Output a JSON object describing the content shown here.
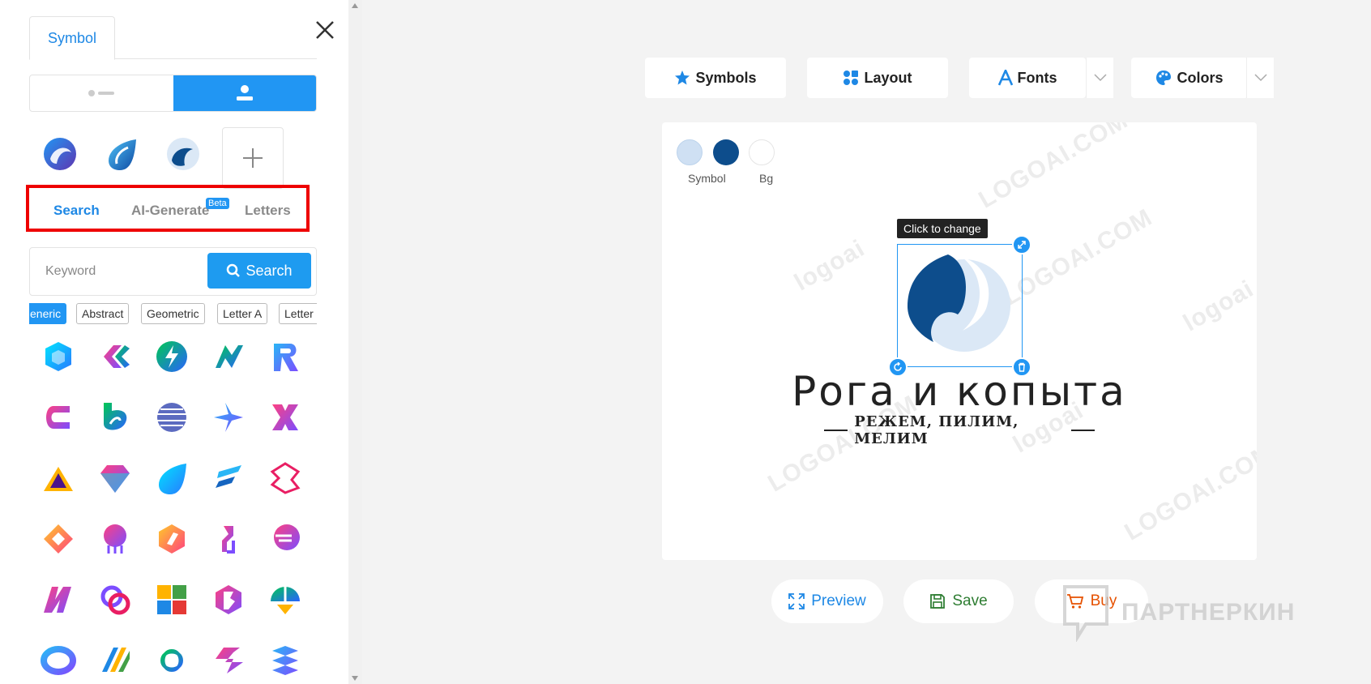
{
  "sidebar": {
    "tab_label": "Symbol",
    "source_tabs": {
      "search": "Search",
      "ai_generate": "AI-Generate",
      "beta_badge": "Beta",
      "letters": "Letters"
    },
    "search": {
      "placeholder": "Keyword",
      "button_label": "Search"
    },
    "chips": [
      "eneric",
      "Abstract",
      "Geometric",
      "Letter A",
      "Letter"
    ]
  },
  "toolbar": {
    "symbols": "Symbols",
    "layout": "Layout",
    "fonts": "Fonts",
    "colors": "Colors"
  },
  "canvas": {
    "swatch_labels": {
      "symbol": "Symbol",
      "bg": "Bg"
    },
    "colors": {
      "light": "#cfe0f3",
      "dark": "#0d4d8c",
      "bg": "#ffffff"
    },
    "tooltip": "Click to change",
    "brand_name": "Рога и копыта",
    "slogan": "РЕЖЕМ, ПИЛИМ, МЕЛИМ",
    "watermarks": [
      "LOGOAI.COM",
      "logoai",
      "LOGOAI.COM",
      "logoai",
      "LOGOAI.COM",
      "logoai",
      "LOGOAI.COM"
    ]
  },
  "actions": {
    "preview": "Preview",
    "save": "Save",
    "buy": "Buy"
  },
  "overlay_watermark": "ПАРТНЕРКИН",
  "accent": "#1e88e5"
}
